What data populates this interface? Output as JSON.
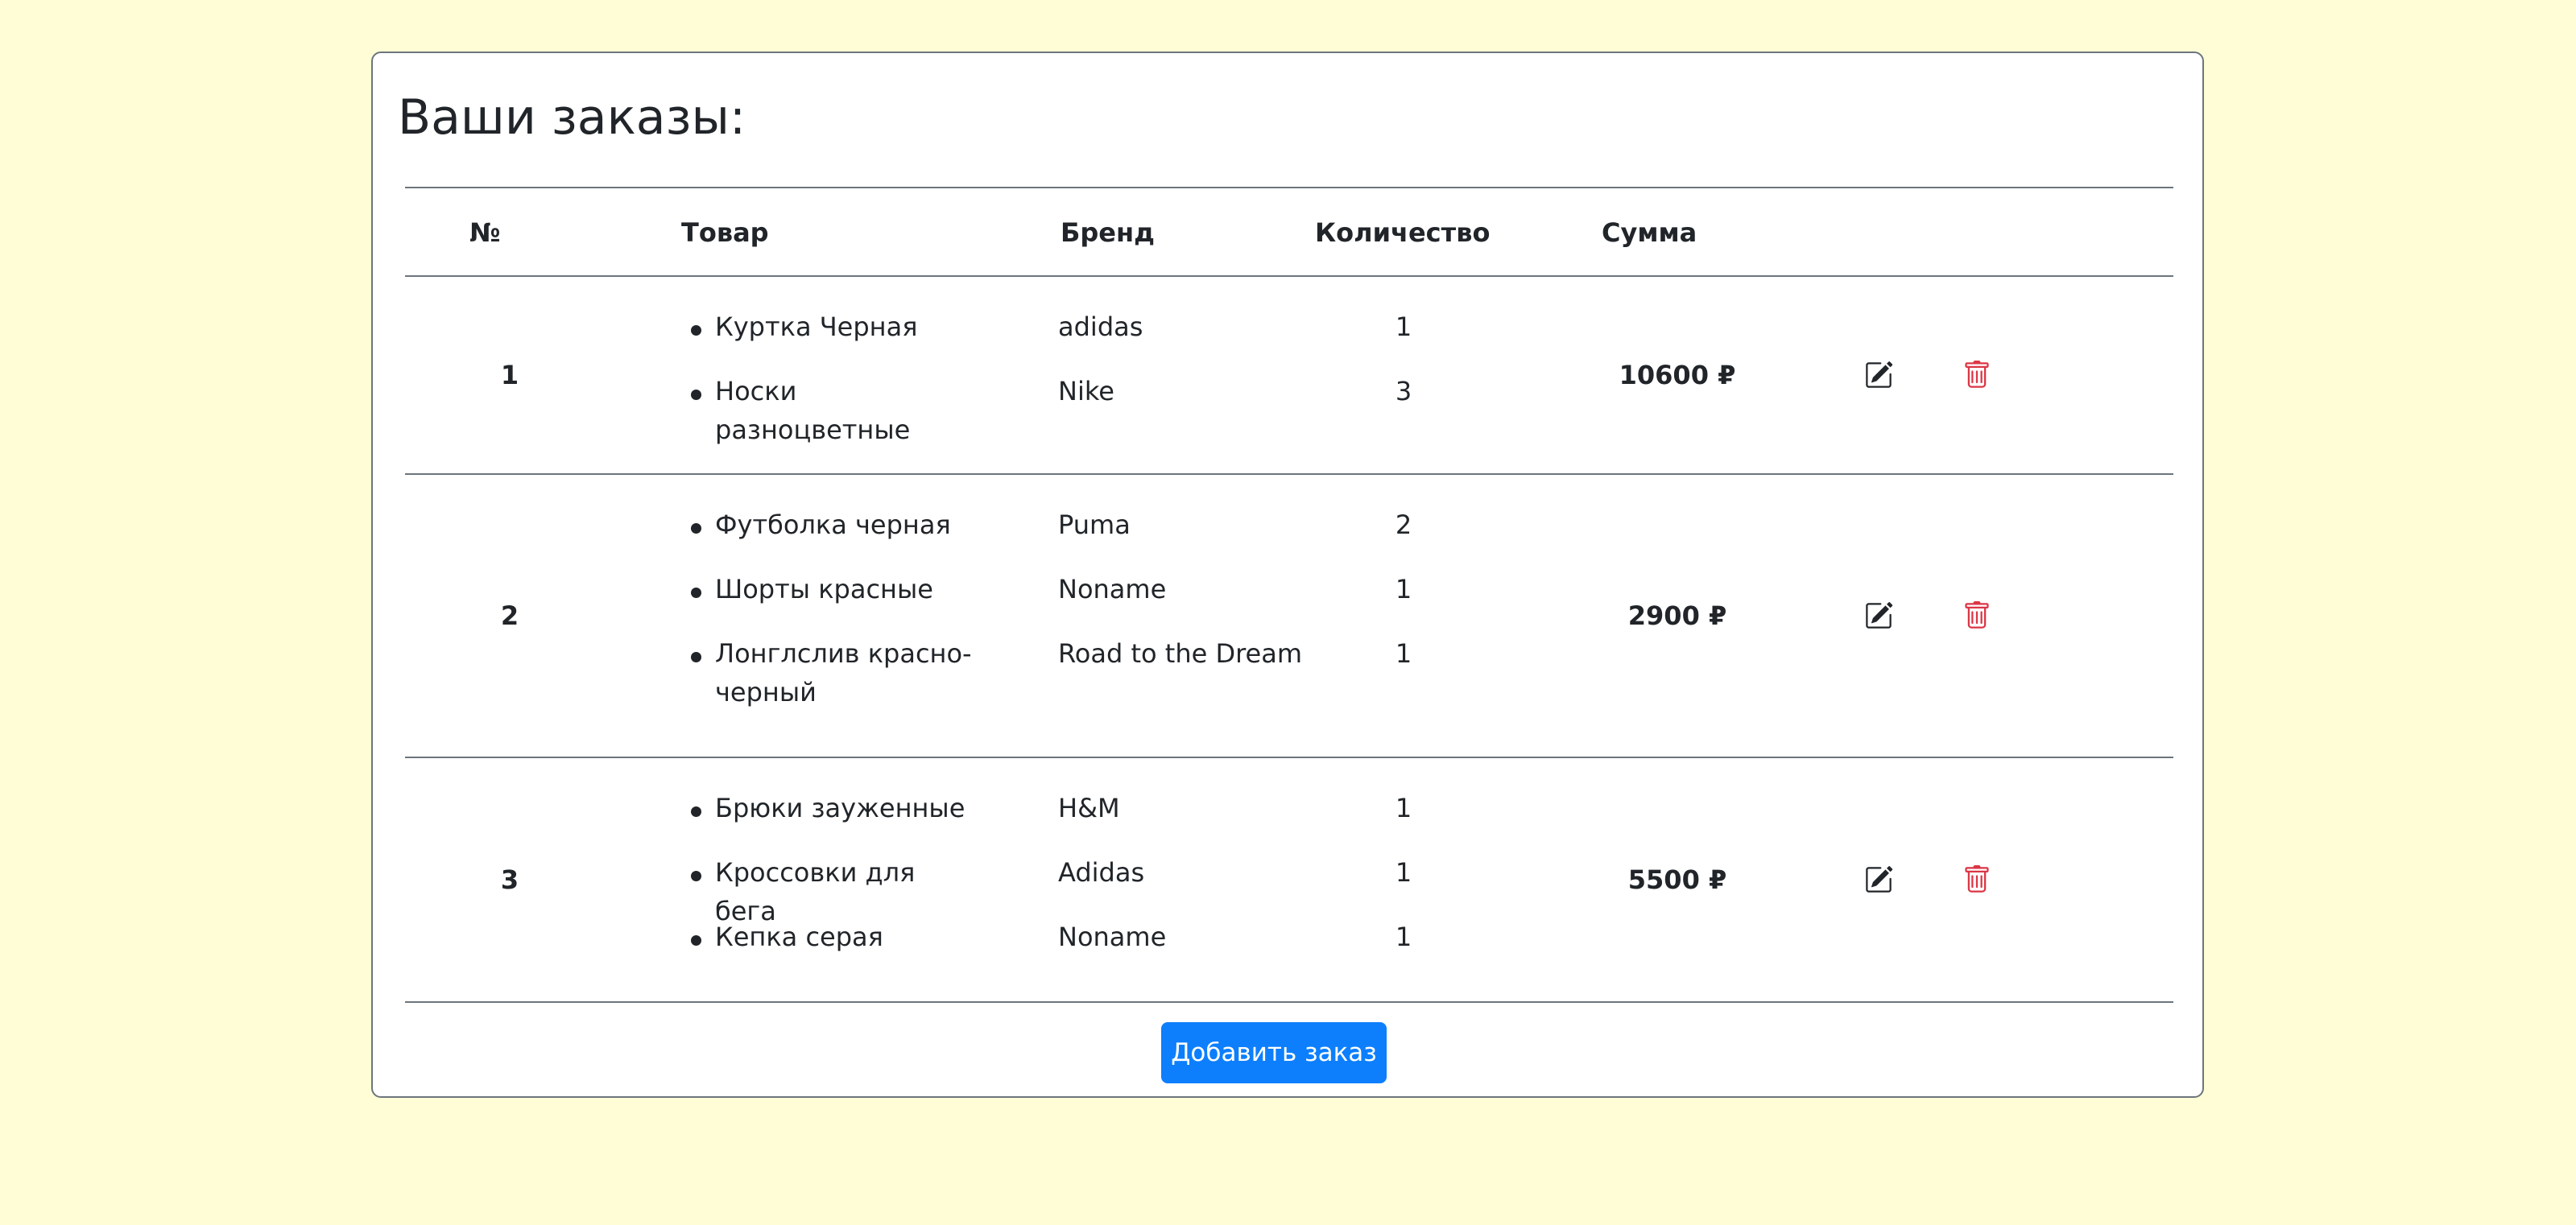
{
  "page": {
    "title": "Ваши заказы:"
  },
  "table": {
    "headers": {
      "num": "№",
      "product": "Товар",
      "brand": "Бренд",
      "qty": "Количество",
      "sum": "Сумма"
    },
    "orders": [
      {
        "num": "1",
        "sum": "10600 ₽",
        "items": [
          {
            "name": "Куртка Черная",
            "brand": "adidas",
            "qty": "1"
          },
          {
            "name": "Носки разноцветные",
            "brand": "Nike",
            "qty": "3"
          }
        ]
      },
      {
        "num": "2",
        "sum": "2900 ₽",
        "items": [
          {
            "name": "Футболка черная",
            "brand": "Puma",
            "qty": "2"
          },
          {
            "name": "Шорты красные",
            "brand": "Noname",
            "qty": "1"
          },
          {
            "name": "Лонглслив красно-черный",
            "brand": "Road to the Dream",
            "qty": "1"
          }
        ]
      },
      {
        "num": "3",
        "sum": "5500 ₽",
        "items": [
          {
            "name": "Брюки зауженные",
            "brand": "H&M",
            "qty": "1"
          },
          {
            "name": "Кроссовки для бега",
            "brand": "Adidas",
            "qty": "1"
          },
          {
            "name": "Кепка серая",
            "brand": "Noname",
            "qty": "1"
          }
        ]
      }
    ]
  },
  "actions": {
    "add_order_label": "Добавить заказ"
  },
  "icons": {
    "edit": "pencil-square-icon",
    "delete": "trash-icon"
  },
  "colors": {
    "page_bg": "#fffdd5",
    "primary": "#0d7ffd",
    "danger": "#dc3545",
    "border": "#6c757d"
  }
}
